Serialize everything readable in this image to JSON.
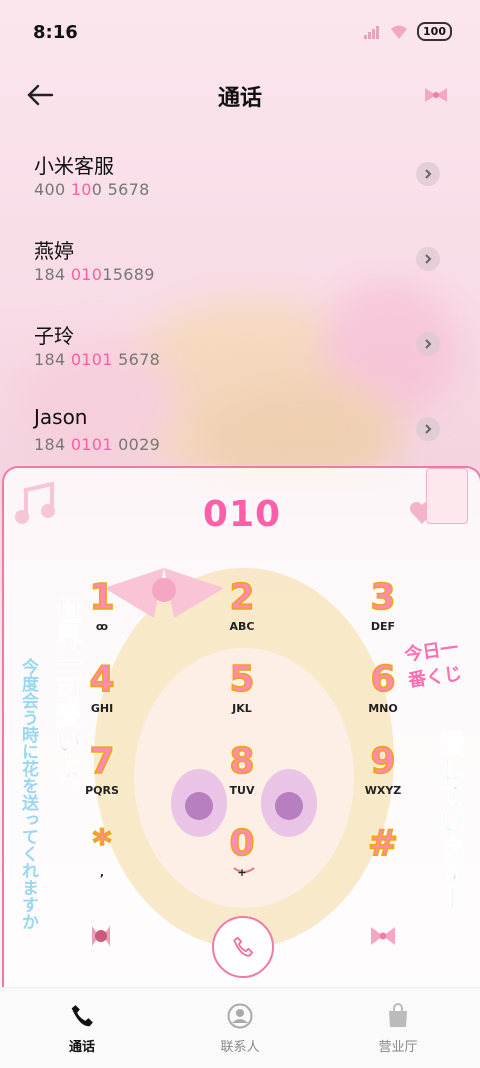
{
  "status_bar": {
    "time": "8:16",
    "battery": "100"
  },
  "header": {
    "title": "通话"
  },
  "contacts": [
    {
      "name": "小米客服",
      "num_parts": [
        "400 ",
        "10",
        "0 5678"
      ]
    },
    {
      "name": "燕婷",
      "num_parts": [
        "184 ",
        "010",
        "15689"
      ]
    },
    {
      "name": "子玲",
      "num_parts": [
        "184 ",
        "0101",
        " 5678"
      ]
    },
    {
      "name": "Jason",
      "num_parts": [
        "184 ",
        "0101",
        " 0029"
      ]
    }
  ],
  "dialer": {
    "entered": "010",
    "keys": [
      {
        "digit": "1",
        "letters": "ꝏ"
      },
      {
        "digit": "2",
        "letters": "ABC"
      },
      {
        "digit": "3",
        "letters": "DEF"
      },
      {
        "digit": "4",
        "letters": "GHI"
      },
      {
        "digit": "5",
        "letters": "JKL"
      },
      {
        "digit": "6",
        "letters": "MNO"
      },
      {
        "digit": "7",
        "letters": "PQRS"
      },
      {
        "digit": "8",
        "letters": "TUV"
      },
      {
        "digit": "9",
        "letters": "WXYZ"
      },
      {
        "digit": "*",
        "letters": ","
      },
      {
        "digit": "0",
        "letters": "+"
      },
      {
        "digit": "#",
        "letters": ""
      }
    ],
    "side_text_left": "世界一可愛いよ。",
    "side_text_left2": "今度会う時に花を送ってくれますか",
    "side_text_right": "愛していますー",
    "side_text_right2": "今日一番くじ"
  },
  "tabs": [
    {
      "label": "通话",
      "active": true
    },
    {
      "label": "联系人",
      "active": false
    },
    {
      "label": "营业厅",
      "active": false
    }
  ],
  "colors": {
    "accent": "#ff5ea8",
    "border": "#ef7aa9"
  }
}
